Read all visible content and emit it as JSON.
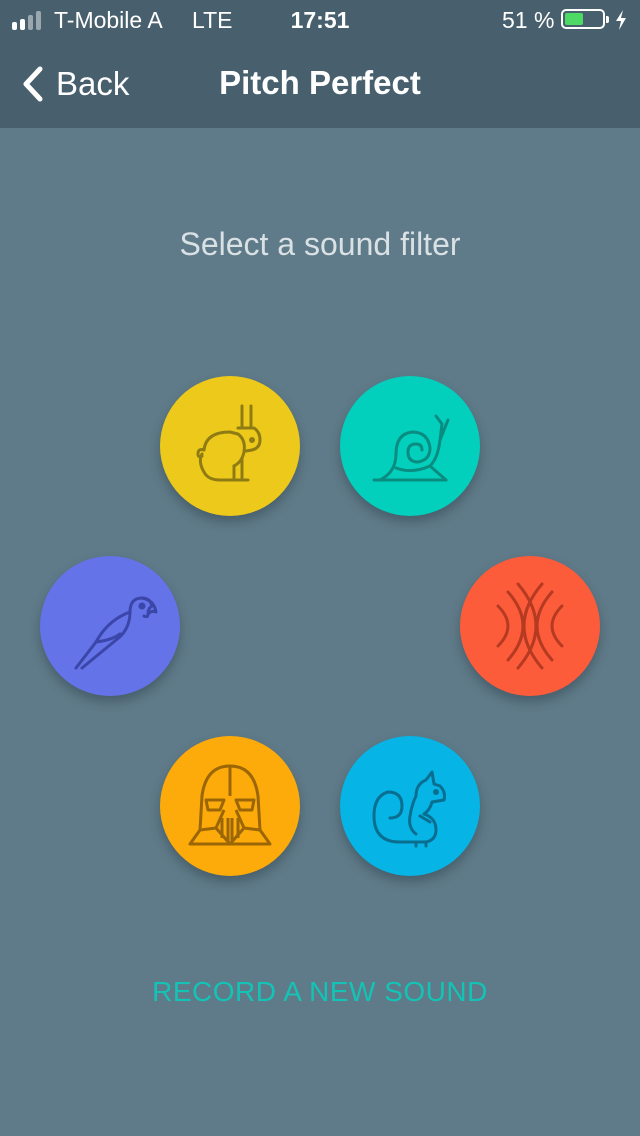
{
  "status_bar": {
    "carrier": "T-Mobile A",
    "network": "LTE",
    "time": "17:51",
    "battery_percent_label": "51 %",
    "battery_level": 0.51,
    "signal_bars_filled": 2,
    "signal_bars_total": 4
  },
  "nav": {
    "back_label": "Back",
    "title": "Pitch Perfect"
  },
  "main": {
    "prompt": "Select a sound filter",
    "filters": [
      {
        "id": "slow",
        "icon": "rabbit-icon",
        "color": "#ecc91a"
      },
      {
        "id": "fast",
        "icon": "snail-icon",
        "color": "#03cfbd"
      },
      {
        "id": "chipmunk",
        "icon": "parrot-icon",
        "color": "#6573e9"
      },
      {
        "id": "echo",
        "icon": "echo-waves-icon",
        "color": "#fd5c3b"
      },
      {
        "id": "vader",
        "icon": "darth-vader-icon",
        "color": "#fdaa0b"
      },
      {
        "id": "reverb",
        "icon": "squirrel-icon",
        "color": "#06b4e6"
      }
    ],
    "record_link": "RECORD A NEW SOUND"
  },
  "colors": {
    "background": "#5f7a88",
    "bar": "#48606d",
    "accent": "#13c4b6"
  }
}
